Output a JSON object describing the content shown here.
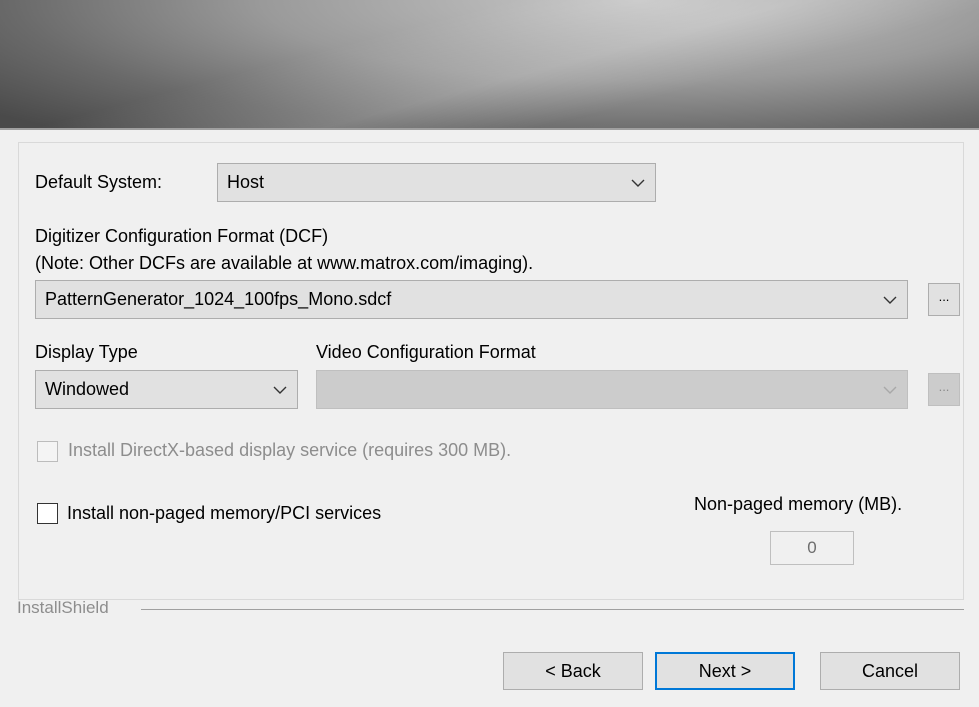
{
  "system": {
    "label": "Default System:",
    "value": "Host"
  },
  "dcf": {
    "title": "Digitizer Configuration Format (DCF)",
    "note": "(Note: Other DCFs are available at www.matrox.com/imaging).",
    "value": "PatternGenerator_1024_100fps_Mono.sdcf",
    "browse_label": "..."
  },
  "display": {
    "label": "Display Type",
    "value": "Windowed"
  },
  "vcf": {
    "label": "Video Configuration Format",
    "value": "",
    "browse_label": "..."
  },
  "directx": {
    "label": "Install DirectX-based display service (requires 300 MB)."
  },
  "nonpaged": {
    "label": "Install non-paged memory/PCI services",
    "memory_label": "Non-paged memory (MB).",
    "memory_value": "0"
  },
  "footer": {
    "brand": "InstallShield",
    "back_label": "< Back",
    "next_label": "Next >",
    "cancel_label": "Cancel"
  }
}
